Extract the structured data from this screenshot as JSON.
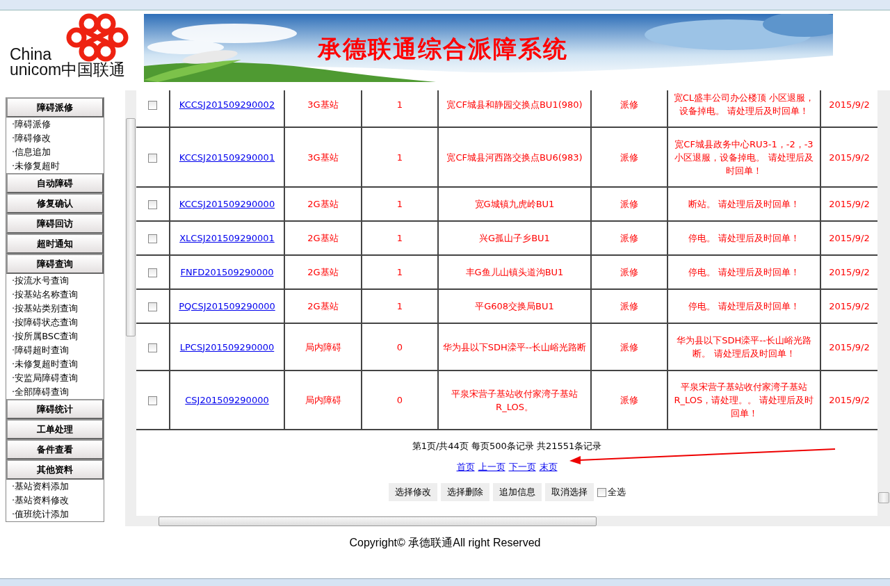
{
  "header": {
    "logo": {
      "line_1": "China",
      "line_2": "unicom中国联通"
    },
    "banner_title": "承德联通综合派障系统"
  },
  "sidebar": [
    {
      "title": "障碍派修",
      "items": [
        "·障碍派修",
        "·障碍修改",
        "·信息追加",
        "·未修复超时"
      ]
    },
    {
      "title": "自动障碍"
    },
    {
      "title": "修复确认"
    },
    {
      "title": "障碍回访"
    },
    {
      "title": "超时通知"
    },
    {
      "title": "障碍查询",
      "items": [
        "·按流水号查询",
        "·按基站名称查询",
        "·按基站类别查询",
        "·按障碍状态查询",
        "·按所属BSC查询",
        "·障碍超时查询",
        "·未修复超时查询",
        "·安监局障碍查询",
        "·全部障碍查询"
      ]
    },
    {
      "title": "障碍统计"
    },
    {
      "title": "工单处理"
    },
    {
      "title": "备件查看"
    },
    {
      "title": "其他资料",
      "items": [
        "·基站资料添加",
        "·基站资料修改",
        "·值班统计添加"
      ]
    }
  ],
  "table": {
    "rows": [
      {
        "checked": false,
        "column_2": "KCCSJ201509290002",
        "column_3": "3G基站",
        "column_4": "1",
        "column_5": "宽CF城县和静园交换点BU1(980)",
        "column_6": "派修",
        "column_7": "宽CL盛丰公司办公楼顶 小区退服，设备掉电。 请处理后及时回单！",
        "column_8": "2015/9/2"
      },
      {
        "checked": false,
        "column_2": "KCCSJ201509290001",
        "column_3": "3G基站",
        "column_4": "1",
        "column_5": "宽CF城县河西路交换点BU6(983)",
        "column_6": "派修",
        "column_7": "宽CF城县政务中心RU3-1，-2，-3小区退服，设备掉电。 请处理后及时回单！",
        "column_8": "2015/9/2"
      },
      {
        "checked": false,
        "column_2": "KCCSJ201509290000",
        "column_3": "2G基站",
        "column_4": "1",
        "column_5": "宽G城镇九虎岭BU1",
        "column_6": "派修",
        "column_7": "断站。 请处理后及时回单！",
        "column_8": "2015/9/2"
      },
      {
        "checked": false,
        "column_2": "XLCSJ201509290001",
        "column_3": "2G基站",
        "column_4": "1",
        "column_5": "兴G孤山子乡BU1",
        "column_6": "派修",
        "column_7": "停电。 请处理后及时回单！",
        "column_8": "2015/9/2"
      },
      {
        "checked": false,
        "column_2": "FNFD201509290000",
        "column_3": "2G基站",
        "column_4": "1",
        "column_5": "丰G鱼儿山镇头道沟BU1",
        "column_6": "派修",
        "column_7": "停电。 请处理后及时回单！",
        "column_8": "2015/9/2"
      },
      {
        "checked": false,
        "column_2": "PQCSJ201509290000",
        "column_3": "2G基站",
        "column_4": "1",
        "column_5": "平G608交换局BU1",
        "column_6": "派修",
        "column_7": "停电。 请处理后及时回单！",
        "column_8": "2015/9/2"
      },
      {
        "checked": false,
        "column_2": "LPCSJ201509290000",
        "column_3": "局内障碍",
        "column_4": "0",
        "column_5": "华为县以下SDH滦平--长山峪光路断",
        "column_6": "派修",
        "column_7": "华为县以下SDH滦平--长山峪光路断。 请处理后及时回单！",
        "column_8": "2015/9/2"
      },
      {
        "checked": false,
        "column_2": "CSJ201509290000",
        "column_3": "局内障碍",
        "column_4": "0",
        "column_5": "平泉宋营子基站收付家湾子基站R_LOS。",
        "column_6": "派修",
        "column_7": "平泉宋营子基站收付家湾子基站R_LOS，请处理。。 请处理后及时回单！",
        "column_8": "2015/9/2"
      }
    ]
  },
  "pagination": {
    "summary": "第1页/共44页 每页500条记录 共21551条记录",
    "links": [
      "首页",
      "上一页",
      "下一页",
      "末页"
    ]
  },
  "actions": {
    "buttons": [
      "选择修改",
      "选择删除",
      "追加信息",
      "取消选择"
    ],
    "select_all": {
      "label": "全选",
      "checked": false
    }
  },
  "footer": {
    "copyright": "Copyright© 承德联通All right Reserved"
  }
}
